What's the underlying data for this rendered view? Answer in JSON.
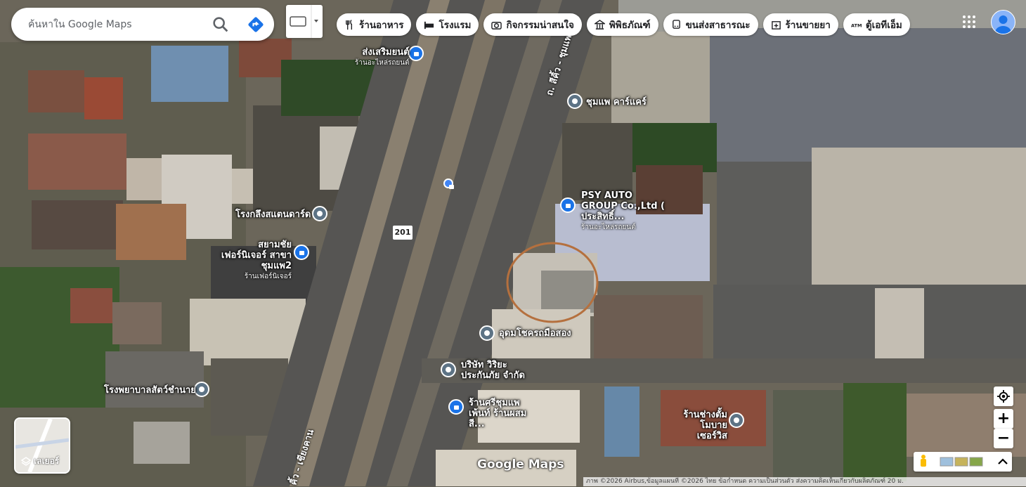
{
  "search": {
    "placeholder": "ค้นหาใน Google Maps"
  },
  "chips": [
    {
      "label": "ร้านอาหาร",
      "icon": "restaurant-icon"
    },
    {
      "label": "โรงแรม",
      "icon": "hotel-icon"
    },
    {
      "label": "กิจกรรมน่าสนใจ",
      "icon": "camera-icon"
    },
    {
      "label": "พิพิธภัณฑ์",
      "icon": "museum-icon"
    },
    {
      "label": "ขนส่งสาธารณะ",
      "icon": "transit-icon"
    },
    {
      "label": "ร้านขายยา",
      "icon": "pharmacy-icon"
    },
    {
      "label": "ตู้เอทีเอ็ม",
      "icon": "atm-icon"
    }
  ],
  "places": [
    {
      "name": "ส่งเสริมยนต์",
      "sub": "ร้านอะไหล่รถยนต์",
      "type": "shop"
    },
    {
      "name": "ชุมแพ คาร์แคร์",
      "sub": "",
      "type": "place"
    },
    {
      "name": "PSY AUTO GROUP Co.,Ltd ( ประสิทธิ์...",
      "sub": "ร้านอะไหล่รถยนต์",
      "type": "shop"
    },
    {
      "name": "โรงกลึงสแตนดาร์ด",
      "sub": "",
      "type": "place"
    },
    {
      "name": "สยามชัยเฟอร์นิเจอร์ สาขาชุมแพ2",
      "sub": "ร้านเฟอร์นิเจอร์",
      "type": "shop"
    },
    {
      "name": "อุดมโชครถมือสอง",
      "sub": "",
      "type": "place"
    },
    {
      "name": "บริษัท วิริยะ ประกันภัย จำกัด",
      "sub": "",
      "type": "place"
    },
    {
      "name": "โรงพยาบาลสัตว์ชำนาย",
      "sub": "",
      "type": "place"
    },
    {
      "name": "ร้านศรีชุมแพ เพ้นท์ ร้านผสมสี...",
      "sub": "",
      "type": "shop"
    },
    {
      "name": "ร้านช่างตั้ม โมบายเซอร์วิส",
      "sub": "",
      "type": "place"
    }
  ],
  "road_labels": {
    "highway_number": "201",
    "road_name_top": "ถ. สีคิ้ว - ชุมแพ",
    "road_name_bottom": "คิ้ว - เชียงคาน"
  },
  "layers_label": "เลเยอร์",
  "logo": "Google Maps",
  "attribution": "ภาพ ©2026 Airbus,ข้อมูลแผนที่ ©2026   ไทย   ข้อกำหนด   ความเป็นส่วนตัว   ส่งความคิดเห็นเกี่ยวกับผลิตภัณฑ์   20 ม.",
  "colors": {
    "accent": "#1a73e8",
    "pin_gray": "#5d7385",
    "highlight_circle": "#b5703e"
  }
}
